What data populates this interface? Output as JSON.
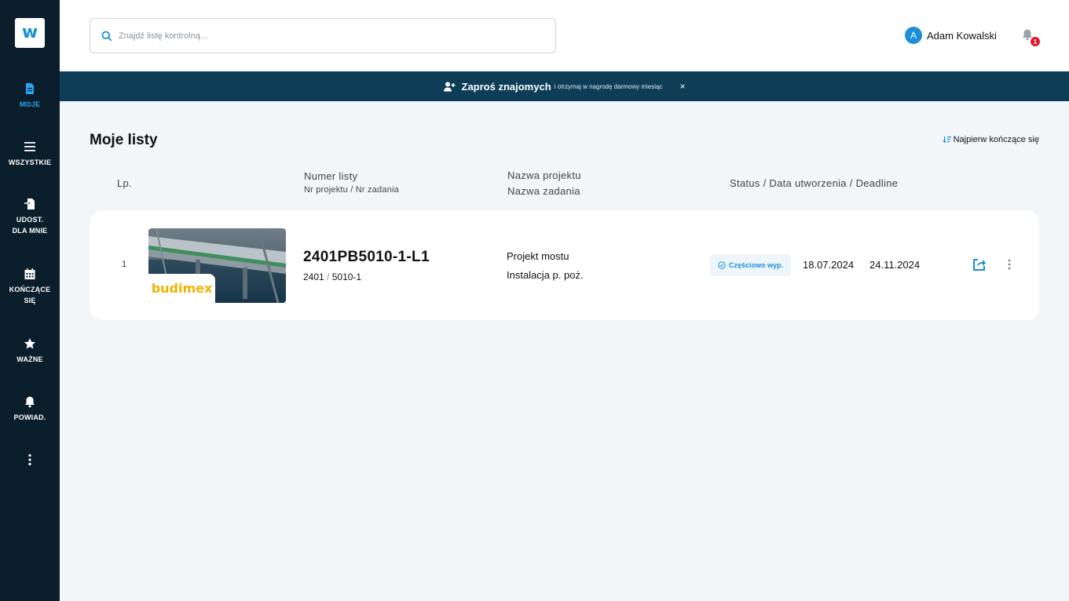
{
  "app": {
    "logo_letter": "w"
  },
  "sidebar": {
    "items": [
      {
        "label": "MOJE",
        "label2": "",
        "icon": "document-icon",
        "active": true
      },
      {
        "label": "WSZYSTKIE",
        "label2": "",
        "icon": "list-icon"
      },
      {
        "label": "UDOST.",
        "label2": "DLA MNIE",
        "icon": "shared-document-icon"
      },
      {
        "label": "KOŃCZĄCE",
        "label2": "SIĘ",
        "icon": "calendar-icon"
      },
      {
        "label": "WAŻNE",
        "label2": "",
        "icon": "star-icon"
      },
      {
        "label": "POWIAD.",
        "label2": "",
        "icon": "bell-icon"
      }
    ]
  },
  "header": {
    "search_placeholder": "Znajdź listę kontrolną...",
    "user_initial": "A",
    "user_name": "Adam Kowalski",
    "notification_count": "1"
  },
  "banner": {
    "strong": "Zaproś znajomych",
    "small": "i otrzymaj w nagrodę darmowy miesiąc",
    "close": "×"
  },
  "main": {
    "title": "Moje listy",
    "sort_label": "Najpierw kończące się",
    "columns": {
      "lp": "Lp.",
      "list_no": "Numer listy",
      "list_no_sub": "Nr projektu / Nr zadania",
      "project": "Nazwa projektu",
      "task": "Nazwa zadania",
      "status": "Status / Data utworzenia / Deadline"
    },
    "rows": [
      {
        "lp": "1",
        "brand": "budimex",
        "list_no": "2401PB5010-1-L1",
        "project_no": "2401",
        "separator": "/",
        "task_no": "5010-1",
        "project_name": "Projekt mostu",
        "task_name": "Instalacja p. poż.",
        "status": "Częściowo wyp.",
        "created": "18.07.2024",
        "deadline": "24.11.2024"
      }
    ]
  },
  "colors": {
    "sidebar": "#0b1e2b",
    "banner": "#0e3d57",
    "accent": "#1a8fd8",
    "badge": "#e4162f",
    "brand": "#f0b400"
  }
}
